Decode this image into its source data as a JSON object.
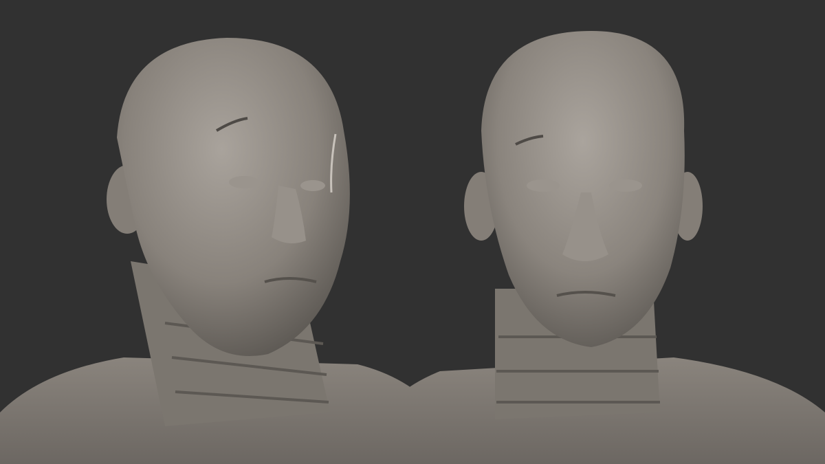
{
  "scene": {
    "subject": "two-sculpt-views",
    "colors": {
      "background": "#313131",
      "clay": "#8d8780",
      "clay_light": "#a8a29b",
      "clay_shadow": "#5e5a55"
    }
  }
}
